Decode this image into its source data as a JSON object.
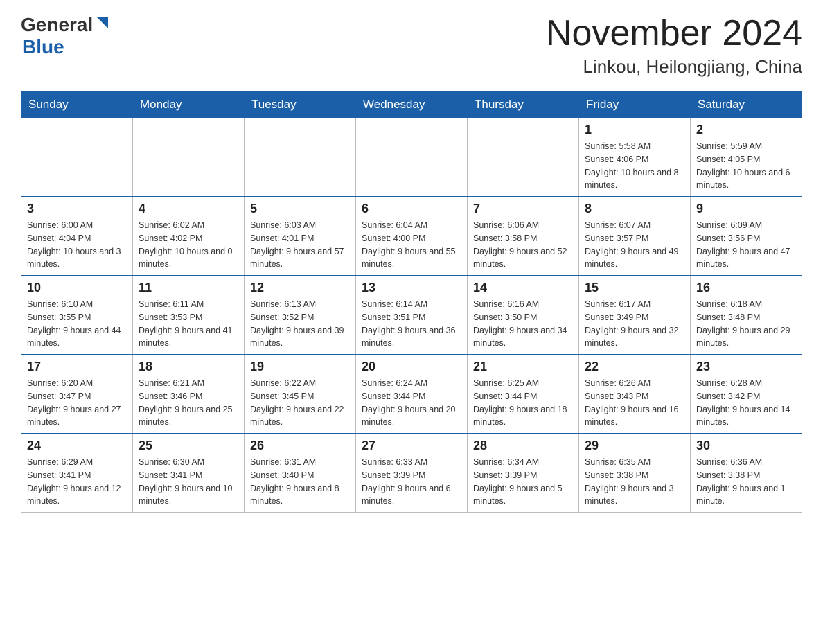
{
  "header": {
    "logo_general": "General",
    "logo_blue": "Blue",
    "title": "November 2024",
    "subtitle": "Linkou, Heilongjiang, China"
  },
  "days_of_week": [
    "Sunday",
    "Monday",
    "Tuesday",
    "Wednesday",
    "Thursday",
    "Friday",
    "Saturday"
  ],
  "weeks": [
    {
      "days": [
        {
          "num": "",
          "info": ""
        },
        {
          "num": "",
          "info": ""
        },
        {
          "num": "",
          "info": ""
        },
        {
          "num": "",
          "info": ""
        },
        {
          "num": "",
          "info": ""
        },
        {
          "num": "1",
          "info": "Sunrise: 5:58 AM\nSunset: 4:06 PM\nDaylight: 10 hours and 8 minutes."
        },
        {
          "num": "2",
          "info": "Sunrise: 5:59 AM\nSunset: 4:05 PM\nDaylight: 10 hours and 6 minutes."
        }
      ]
    },
    {
      "days": [
        {
          "num": "3",
          "info": "Sunrise: 6:00 AM\nSunset: 4:04 PM\nDaylight: 10 hours and 3 minutes."
        },
        {
          "num": "4",
          "info": "Sunrise: 6:02 AM\nSunset: 4:02 PM\nDaylight: 10 hours and 0 minutes."
        },
        {
          "num": "5",
          "info": "Sunrise: 6:03 AM\nSunset: 4:01 PM\nDaylight: 9 hours and 57 minutes."
        },
        {
          "num": "6",
          "info": "Sunrise: 6:04 AM\nSunset: 4:00 PM\nDaylight: 9 hours and 55 minutes."
        },
        {
          "num": "7",
          "info": "Sunrise: 6:06 AM\nSunset: 3:58 PM\nDaylight: 9 hours and 52 minutes."
        },
        {
          "num": "8",
          "info": "Sunrise: 6:07 AM\nSunset: 3:57 PM\nDaylight: 9 hours and 49 minutes."
        },
        {
          "num": "9",
          "info": "Sunrise: 6:09 AM\nSunset: 3:56 PM\nDaylight: 9 hours and 47 minutes."
        }
      ]
    },
    {
      "days": [
        {
          "num": "10",
          "info": "Sunrise: 6:10 AM\nSunset: 3:55 PM\nDaylight: 9 hours and 44 minutes."
        },
        {
          "num": "11",
          "info": "Sunrise: 6:11 AM\nSunset: 3:53 PM\nDaylight: 9 hours and 41 minutes."
        },
        {
          "num": "12",
          "info": "Sunrise: 6:13 AM\nSunset: 3:52 PM\nDaylight: 9 hours and 39 minutes."
        },
        {
          "num": "13",
          "info": "Sunrise: 6:14 AM\nSunset: 3:51 PM\nDaylight: 9 hours and 36 minutes."
        },
        {
          "num": "14",
          "info": "Sunrise: 6:16 AM\nSunset: 3:50 PM\nDaylight: 9 hours and 34 minutes."
        },
        {
          "num": "15",
          "info": "Sunrise: 6:17 AM\nSunset: 3:49 PM\nDaylight: 9 hours and 32 minutes."
        },
        {
          "num": "16",
          "info": "Sunrise: 6:18 AM\nSunset: 3:48 PM\nDaylight: 9 hours and 29 minutes."
        }
      ]
    },
    {
      "days": [
        {
          "num": "17",
          "info": "Sunrise: 6:20 AM\nSunset: 3:47 PM\nDaylight: 9 hours and 27 minutes."
        },
        {
          "num": "18",
          "info": "Sunrise: 6:21 AM\nSunset: 3:46 PM\nDaylight: 9 hours and 25 minutes."
        },
        {
          "num": "19",
          "info": "Sunrise: 6:22 AM\nSunset: 3:45 PM\nDaylight: 9 hours and 22 minutes."
        },
        {
          "num": "20",
          "info": "Sunrise: 6:24 AM\nSunset: 3:44 PM\nDaylight: 9 hours and 20 minutes."
        },
        {
          "num": "21",
          "info": "Sunrise: 6:25 AM\nSunset: 3:44 PM\nDaylight: 9 hours and 18 minutes."
        },
        {
          "num": "22",
          "info": "Sunrise: 6:26 AM\nSunset: 3:43 PM\nDaylight: 9 hours and 16 minutes."
        },
        {
          "num": "23",
          "info": "Sunrise: 6:28 AM\nSunset: 3:42 PM\nDaylight: 9 hours and 14 minutes."
        }
      ]
    },
    {
      "days": [
        {
          "num": "24",
          "info": "Sunrise: 6:29 AM\nSunset: 3:41 PM\nDaylight: 9 hours and 12 minutes."
        },
        {
          "num": "25",
          "info": "Sunrise: 6:30 AM\nSunset: 3:41 PM\nDaylight: 9 hours and 10 minutes."
        },
        {
          "num": "26",
          "info": "Sunrise: 6:31 AM\nSunset: 3:40 PM\nDaylight: 9 hours and 8 minutes."
        },
        {
          "num": "27",
          "info": "Sunrise: 6:33 AM\nSunset: 3:39 PM\nDaylight: 9 hours and 6 minutes."
        },
        {
          "num": "28",
          "info": "Sunrise: 6:34 AM\nSunset: 3:39 PM\nDaylight: 9 hours and 5 minutes."
        },
        {
          "num": "29",
          "info": "Sunrise: 6:35 AM\nSunset: 3:38 PM\nDaylight: 9 hours and 3 minutes."
        },
        {
          "num": "30",
          "info": "Sunrise: 6:36 AM\nSunset: 3:38 PM\nDaylight: 9 hours and 1 minute."
        }
      ]
    }
  ]
}
